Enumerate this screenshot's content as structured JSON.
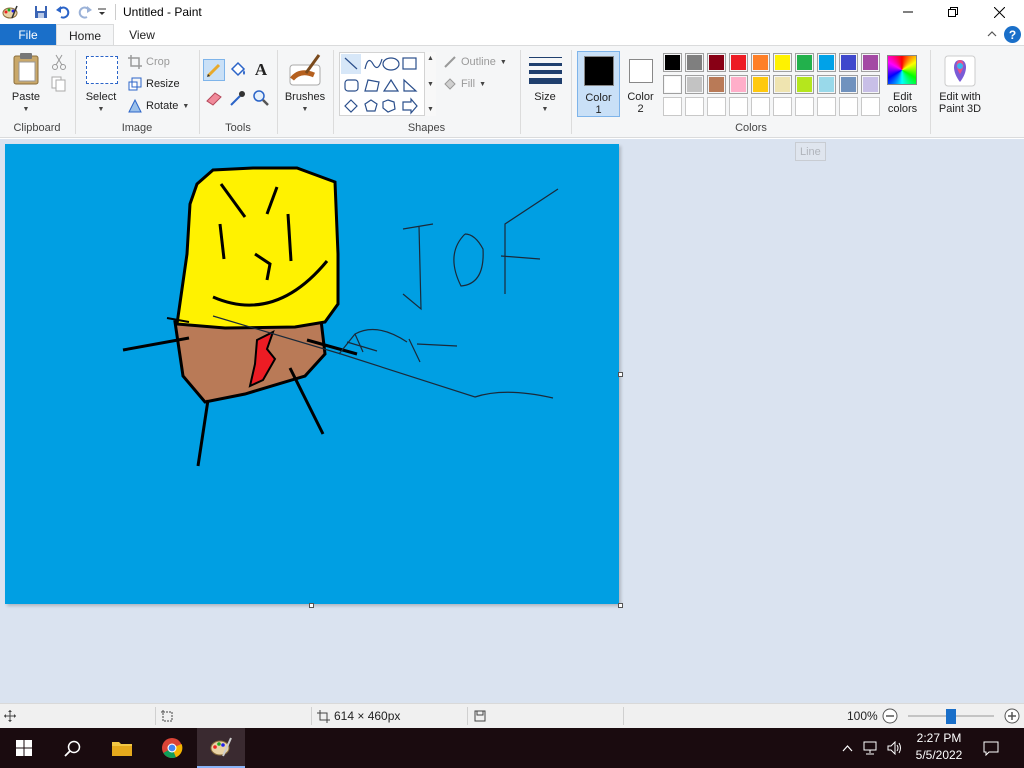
{
  "window": {
    "title": "Untitled - Paint",
    "minimize_icon": "minimize-icon",
    "maximize_icon": "restore-icon",
    "close_icon": "close-icon"
  },
  "tabs": {
    "file": "File",
    "home": "Home",
    "view": "View",
    "help": "?"
  },
  "ribbon": {
    "clipboard": {
      "label": "Clipboard",
      "paste": "Paste"
    },
    "image": {
      "label": "Image",
      "select": "Select",
      "crop": "Crop",
      "resize": "Resize",
      "rotate": "Rotate"
    },
    "tools": {
      "label": "Tools"
    },
    "brushes": {
      "label": "Brushes"
    },
    "shapes": {
      "label": "Shapes",
      "outline": "Outline",
      "fill": "Fill"
    },
    "size": {
      "label": "Size"
    },
    "colors": {
      "label": "Colors",
      "color1": "Color\n1",
      "color1_line1": "Color",
      "color1_line2": "1",
      "color2_line1": "Color",
      "color2_line2": "2",
      "edit_colors_line1": "Edit",
      "edit_colors_line2": "colors",
      "paint3d_line1": "Edit with",
      "paint3d_line2": "Paint 3D",
      "palette_row1": [
        "#000000",
        "#7f7f7f",
        "#880015",
        "#ed1c24",
        "#ff7f27",
        "#fff200",
        "#22b14c",
        "#00a2e8",
        "#3f48cc",
        "#a349a4"
      ],
      "palette_row2": [
        "#ffffff",
        "#c3c3c3",
        "#b97a57",
        "#ffaec9",
        "#ffc90e",
        "#efe4b0",
        "#b5e61d",
        "#99d9ea",
        "#7092be",
        "#c8bfe7"
      ],
      "primary": "#000000",
      "secondary": "#ffffff"
    }
  },
  "canvas": {
    "background": "#009fe3",
    "tooltip": "Line"
  },
  "statusbar": {
    "dimensions": "614 × 460px",
    "zoom": "100%"
  },
  "taskbar": {
    "time": "2:27 PM",
    "date": "5/5/2022"
  }
}
